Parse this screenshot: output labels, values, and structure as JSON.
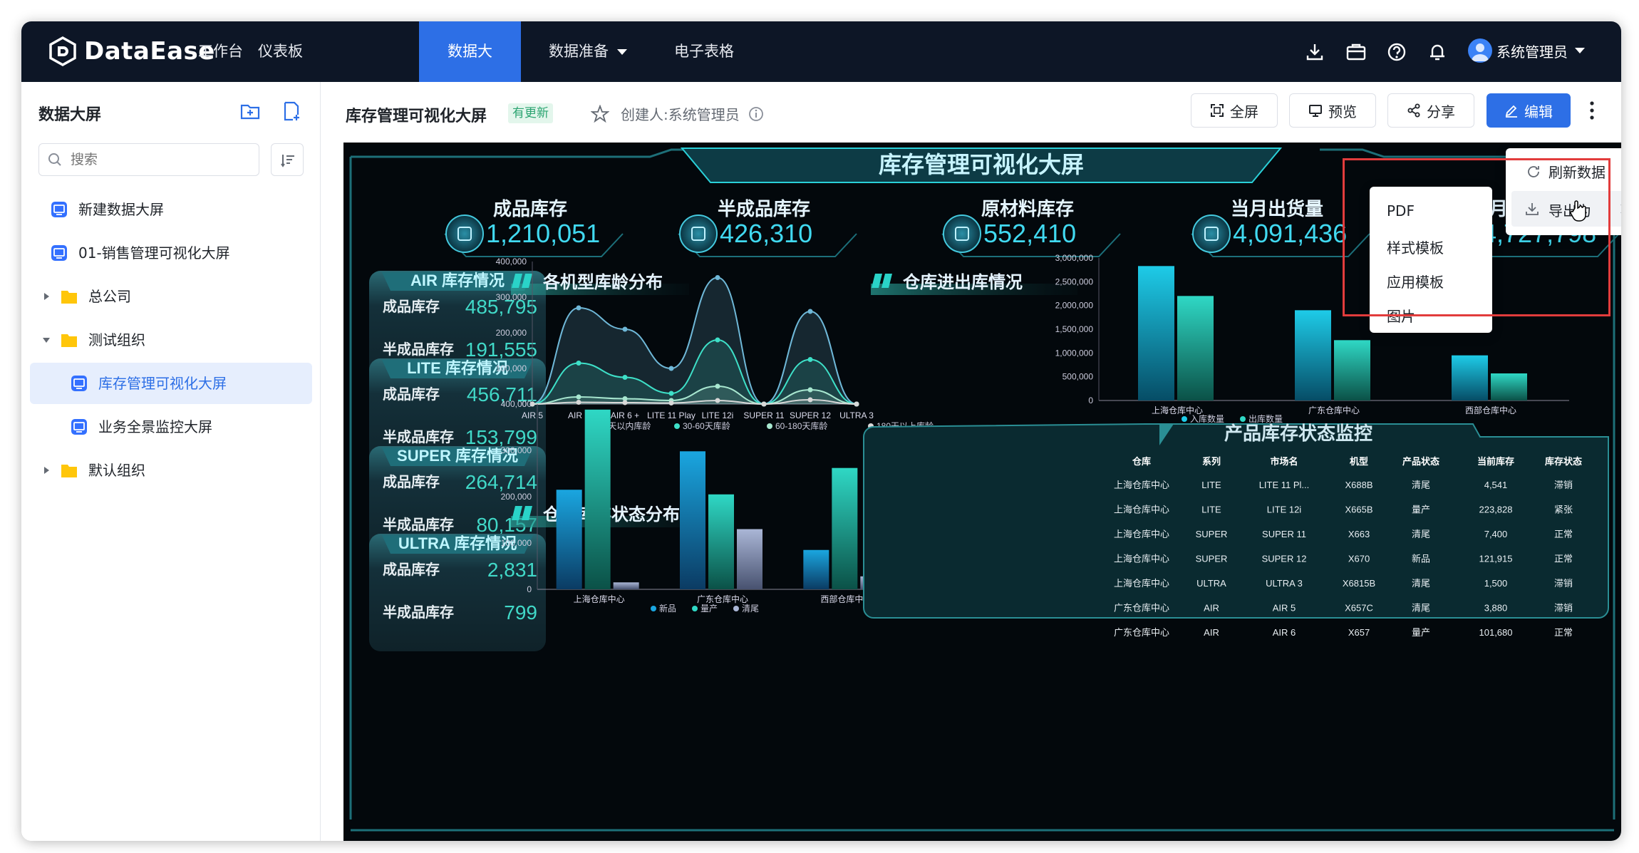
{
  "app": {
    "brand": "DataEase"
  },
  "nav": [
    {
      "label": "工作台"
    },
    {
      "label": "仪表板"
    },
    {
      "label": "数据大屏"
    },
    {
      "label": "数据准备"
    },
    {
      "label": "电子表格"
    }
  ],
  "user": {
    "name": "系统管理员"
  },
  "sidebar": {
    "title": "数据大屏",
    "search_placeholder": "搜索",
    "items": [
      {
        "label": "新建数据大屏"
      },
      {
        "label": "01-销售管理可视化大屏"
      },
      {
        "label": "总公司"
      },
      {
        "label": "测试组织"
      },
      {
        "label": "库存管理可视化大屏"
      },
      {
        "label": "业务全景监控大屏"
      },
      {
        "label": "默认组织"
      }
    ]
  },
  "header": {
    "title": "库存管理可视化大屏",
    "badge": "有更新",
    "creator": "创建人:系统管理员",
    "buttons": {
      "fullscreen": "全屏",
      "preview": "预览",
      "share": "分享",
      "edit": "编辑"
    }
  },
  "menu": {
    "refresh": "刷新数据",
    "export": "导出为",
    "submenu": [
      "PDF",
      "样式模板",
      "应用模板",
      "图片"
    ]
  },
  "dashboard": {
    "title": "库存管理可视化大屏",
    "kpis": [
      {
        "label": "成品库存",
        "value": "1,210,051"
      },
      {
        "label": "半成品库存",
        "value": "426,310"
      },
      {
        "label": "原材料库存",
        "value": "552,410"
      },
      {
        "label": "当月出货量",
        "value": "4,091,436"
      },
      {
        "label": "月入库量",
        "value": "4,727,798"
      }
    ],
    "panels": [
      {
        "title": "AIR 库存情况",
        "r1": "成品库存",
        "v1": "485,795",
        "r2": "半成品库存",
        "v2": "191,555"
      },
      {
        "title": "LITE 库存情况",
        "r1": "成品库存",
        "v1": "456,711",
        "r2": "半成品库存",
        "v2": "153,799"
      },
      {
        "title": "SUPER 库存情况",
        "r1": "成品库存",
        "v1": "264,714",
        "r2": "半成品库存",
        "v2": "80,157"
      },
      {
        "title": "ULTRA 库存情况",
        "r1": "成品库存",
        "v1": "2,831",
        "r2": "半成品库存",
        "v2": "799"
      }
    ],
    "chart_titles": {
      "age": "各机型库龄分布",
      "status": "仓库库存状态分布",
      "io": "仓库进出库情况",
      "monitor": "产品库存状态监控"
    },
    "table": {
      "headers": [
        "仓库",
        "系列",
        "市场名",
        "机型",
        "产品状态",
        "当前库存",
        "库存状态"
      ],
      "rows": [
        [
          "上海仓库中心",
          "LITE",
          "LITE 11 Pl...",
          "X688B",
          "清尾",
          "4,541",
          "滞销"
        ],
        [
          "上海仓库中心",
          "LITE",
          "LITE 12i",
          "X665B",
          "量产",
          "223,828",
          "紧张"
        ],
        [
          "上海仓库中心",
          "SUPER",
          "SUPER 11",
          "X663",
          "清尾",
          "7,400",
          "正常"
        ],
        [
          "上海仓库中心",
          "SUPER",
          "SUPER 12",
          "X670",
          "新品",
          "121,915",
          "正常"
        ],
        [
          "上海仓库中心",
          "ULTRA",
          "ULTRA 3",
          "X6815B",
          "清尾",
          "1,500",
          "滞销"
        ],
        [
          "广东仓库中心",
          "AIR",
          "AIR 5",
          "X657C",
          "清尾",
          "3,880",
          "滞销"
        ],
        [
          "广东仓库中心",
          "AIR",
          "AIR 6",
          "X657",
          "量产",
          "101,680",
          "正常"
        ]
      ]
    }
  },
  "chart_data": [
    {
      "type": "area",
      "title": "各机型库龄分布",
      "categories": [
        "AIR 5",
        "AIR 6",
        "AIR 6 +",
        "LITE 11 Play",
        "LITE 12i",
        "SUPER 11",
        "SUPER 12",
        "ULTRA 3"
      ],
      "ylim": [
        0,
        400000
      ],
      "yticks": [
        "0",
        "100,000",
        "200,000",
        "300,000",
        "400,000"
      ],
      "series": [
        {
          "name": "30天以内库龄",
          "values": [
            0,
            270000,
            210000,
            100000,
            355000,
            0,
            260000,
            0
          ]
        },
        {
          "name": "30-60天库龄",
          "values": [
            0,
            115000,
            75000,
            30000,
            180000,
            0,
            125000,
            0
          ]
        },
        {
          "name": "60-180天库龄",
          "values": [
            0,
            20000,
            15000,
            10000,
            50000,
            0,
            40000,
            0
          ]
        },
        {
          "name": "180天以上库龄",
          "values": [
            0,
            5000,
            4000,
            3000,
            10000,
            0,
            12000,
            0
          ]
        }
      ]
    },
    {
      "type": "bar",
      "title": "仓库库存状态分布",
      "categories": [
        "上海仓库中心",
        "广东仓库中心",
        "西部仓库中心"
      ],
      "ylim": [
        0,
        400000
      ],
      "yticks": [
        "0",
        "100,000",
        "200,000",
        "300,000",
        "400,000"
      ],
      "series": [
        {
          "name": "新品",
          "values": [
            215000,
            298000,
            85000
          ]
        },
        {
          "name": "量产",
          "values": [
            388000,
            205000,
            262000
          ]
        },
        {
          "name": "清尾",
          "values": [
            15000,
            130000,
            28000
          ]
        }
      ]
    },
    {
      "type": "bar",
      "title": "仓库进出库情况",
      "categories": [
        "上海仓库中心",
        "广东仓库中心",
        "西部仓库中心"
      ],
      "ylim": [
        0,
        3000000
      ],
      "yticks": [
        "0",
        "500,000",
        "1,000,000",
        "1,500,000",
        "2,000,000",
        "2,500,000",
        "3,000,000"
      ],
      "series": [
        {
          "name": "入库数量",
          "values": [
            2830000,
            1900000,
            950000
          ]
        },
        {
          "name": "出库数量",
          "values": [
            2200000,
            1270000,
            570000
          ]
        }
      ]
    }
  ]
}
